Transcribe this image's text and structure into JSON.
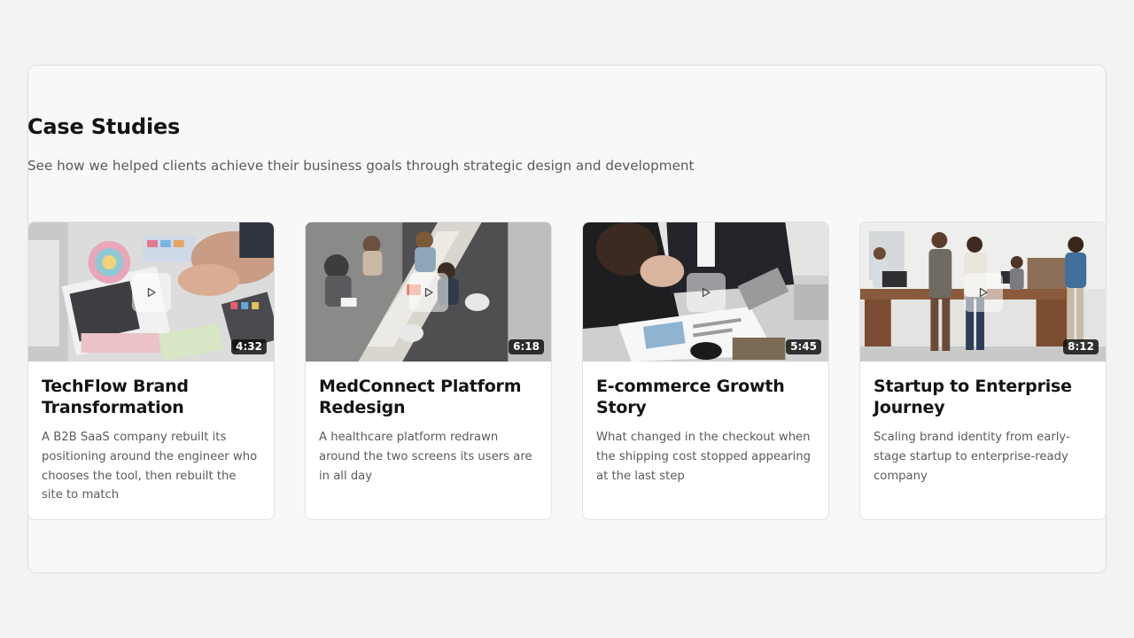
{
  "section": {
    "title": "Case Studies",
    "subtitle": "See how we helped clients achieve their business goals through strategic design and development"
  },
  "cards": [
    {
      "title": "TechFlow Brand Transformation",
      "description": "A B2B SaaS company rebuilt its positioning around the engineer who chooses the tool, then rebuilt the site to match",
      "duration": "4:32",
      "thumbnail": "designer-with-color-swatches"
    },
    {
      "title": "MedConnect Platform Redesign",
      "description": "A healthcare platform redrawn around the two screens its users are in all day",
      "duration": "6:18",
      "thumbnail": "team-meeting-overhead"
    },
    {
      "title": "E-commerce Growth Story",
      "description": "What changed in the checkout when the shipping cost stopped appearing at the last step",
      "duration": "5:45",
      "thumbnail": "business-documents-review"
    },
    {
      "title": "Startup to Enterprise Journey",
      "description": "Scaling brand identity from early-stage startup to enterprise-ready company",
      "duration": "8:12",
      "thumbnail": "team-standing-office"
    }
  ],
  "icons": {
    "play": "play-icon"
  },
  "colors": {
    "page_background": "#f3f3f3",
    "panel_background": "#f8f8f8",
    "text_primary": "#141414",
    "text_secondary": "#5b5b5b",
    "badge_background": "#0c0c0c"
  }
}
